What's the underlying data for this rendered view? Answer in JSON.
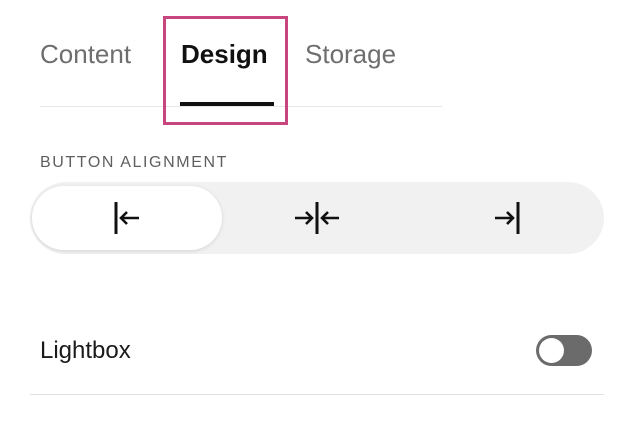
{
  "tabs": [
    {
      "label": "Content",
      "active": false
    },
    {
      "label": "Design",
      "active": true
    },
    {
      "label": "Storage",
      "active": false
    }
  ],
  "button_alignment": {
    "label": "BUTTON ALIGNMENT",
    "options": [
      {
        "icon": "align-left-icon",
        "selected": true
      },
      {
        "icon": "align-center-icon",
        "selected": false
      },
      {
        "icon": "align-right-icon",
        "selected": false
      }
    ]
  },
  "lightbox": {
    "label": "Lightbox",
    "enabled": false
  },
  "colors": {
    "highlight": "#c8457e",
    "toggle_off": "#6b6b6b"
  }
}
